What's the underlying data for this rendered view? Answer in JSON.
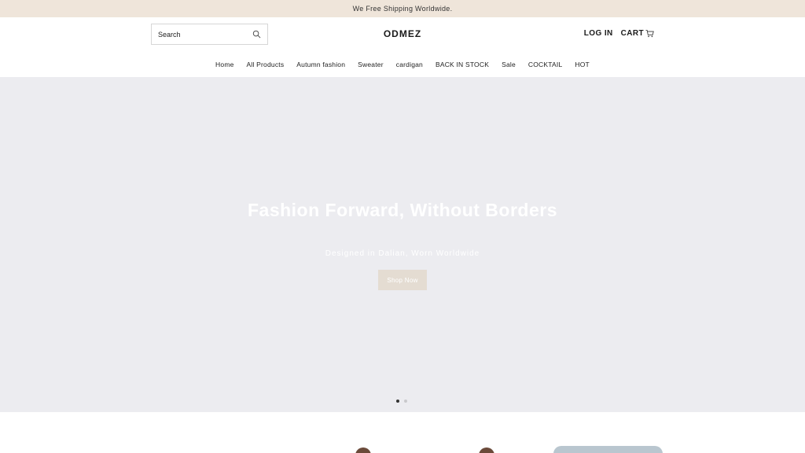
{
  "announcement": {
    "text": "We Free Shipping Worldwide."
  },
  "header": {
    "search_placeholder": "Search",
    "logo": "ODMEZ",
    "login_label": "LOG IN",
    "cart_label": "CART"
  },
  "nav": {
    "items": [
      {
        "label": "Home"
      },
      {
        "label": "All Products"
      },
      {
        "label": "Autumn fashion"
      },
      {
        "label": "Sweater"
      },
      {
        "label": "cardigan"
      },
      {
        "label": "BACK IN STOCK"
      },
      {
        "label": "Sale"
      },
      {
        "label": "COCKTAIL"
      },
      {
        "label": "HOT"
      }
    ]
  },
  "hero": {
    "title": "Fashion Forward, Without Borders",
    "subtitle": "Designed in Dalian, Worn Worldwide",
    "button_label": "Shop Now",
    "slide_count": 2,
    "active_slide": 1
  },
  "colors": {
    "announcement_bg": "#efe5da",
    "hero_bg": "#ececf0",
    "button_bg": "#e4dcd2"
  },
  "icons": {
    "search": "search-icon",
    "cart": "cart-icon"
  }
}
